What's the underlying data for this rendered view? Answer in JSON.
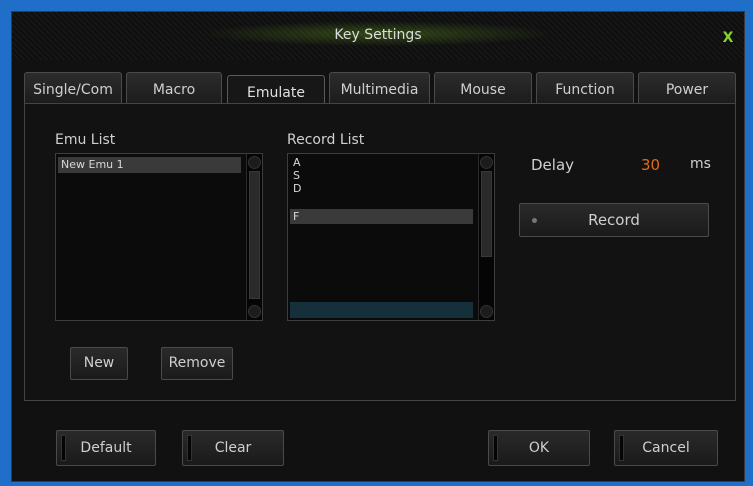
{
  "window": {
    "title": "Key Settings",
    "close_label": "X",
    "accent": "#86d32b"
  },
  "tabs": [
    {
      "label": "Single/Com"
    },
    {
      "label": "Macro"
    },
    {
      "label": "Emulate",
      "active": true
    },
    {
      "label": "Multimedia"
    },
    {
      "label": "Mouse"
    },
    {
      "label": "Function"
    },
    {
      "label": "Power"
    }
  ],
  "emu": {
    "list_label": "Emu List",
    "items": [
      "New Emu 1"
    ],
    "new_label": "New",
    "remove_label": "Remove"
  },
  "record": {
    "list_label": "Record List",
    "items": [
      "A",
      "S",
      "D",
      "F"
    ],
    "selected_index": 3,
    "delay_label": "Delay",
    "delay_value": "30",
    "delay_unit": "ms",
    "delay_color": "#e06a1a",
    "record_button": "Record"
  },
  "footer": {
    "default_label": "Default",
    "clear_label": "Clear",
    "ok_label": "OK",
    "cancel_label": "Cancel"
  }
}
